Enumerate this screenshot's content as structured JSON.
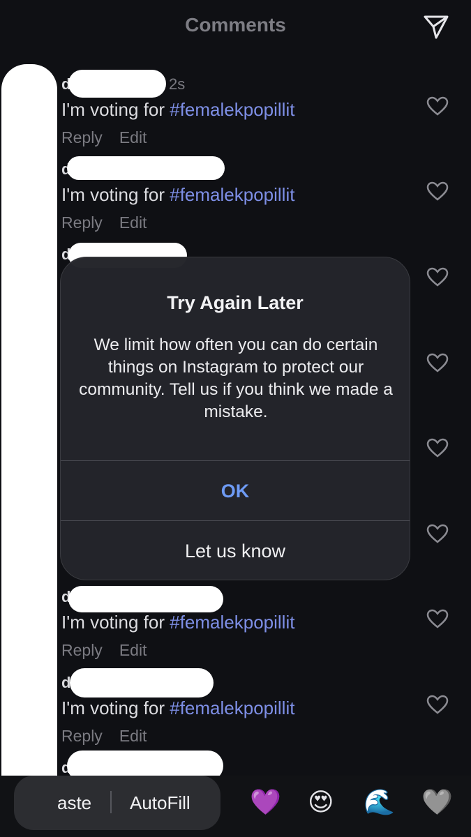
{
  "header": {
    "title": "Comments",
    "send_icon": "send-icon"
  },
  "comments": [
    {
      "user": "d",
      "time": "2s",
      "text": "I'm voting for ",
      "hashtag": "#femalekpopillit",
      "reply": "Reply",
      "edit": "Edit"
    },
    {
      "user": "d",
      "time": "",
      "text": "I'm voting for ",
      "hashtag": "#femalekpopillit",
      "reply": "Reply",
      "edit": "Edit"
    },
    {
      "user": "d",
      "time": "",
      "text": "",
      "hashtag": "",
      "reply": "",
      "edit": ""
    },
    {
      "user": "d",
      "time": "",
      "text": "I'm voting for ",
      "hashtag": "#femalekpopillit",
      "reply": "Reply",
      "edit": "Edit"
    },
    {
      "user": "d",
      "time": "",
      "text": "I'm voting for ",
      "hashtag": "#femalekpopillit",
      "reply": "Reply",
      "edit": "Edit"
    },
    {
      "user": "d",
      "time": "",
      "text": "",
      "hashtag": "",
      "reply": "",
      "edit": ""
    }
  ],
  "alert": {
    "title": "Try Again Later",
    "message": "We limit how often you can do certain things on Instagram to protect our community. Tell us if you think we made a mistake.",
    "ok_label": "OK",
    "report_label": "Let us know"
  },
  "keyboard": {
    "paste_label": "aste",
    "autofill_label": "AutoFill",
    "emojis": [
      "💜",
      "😍",
      "🌊",
      "🩶"
    ]
  },
  "colors": {
    "background": "#0f1014",
    "hashtag": "#7e8fe6",
    "ok_button": "#6e9bf5"
  }
}
